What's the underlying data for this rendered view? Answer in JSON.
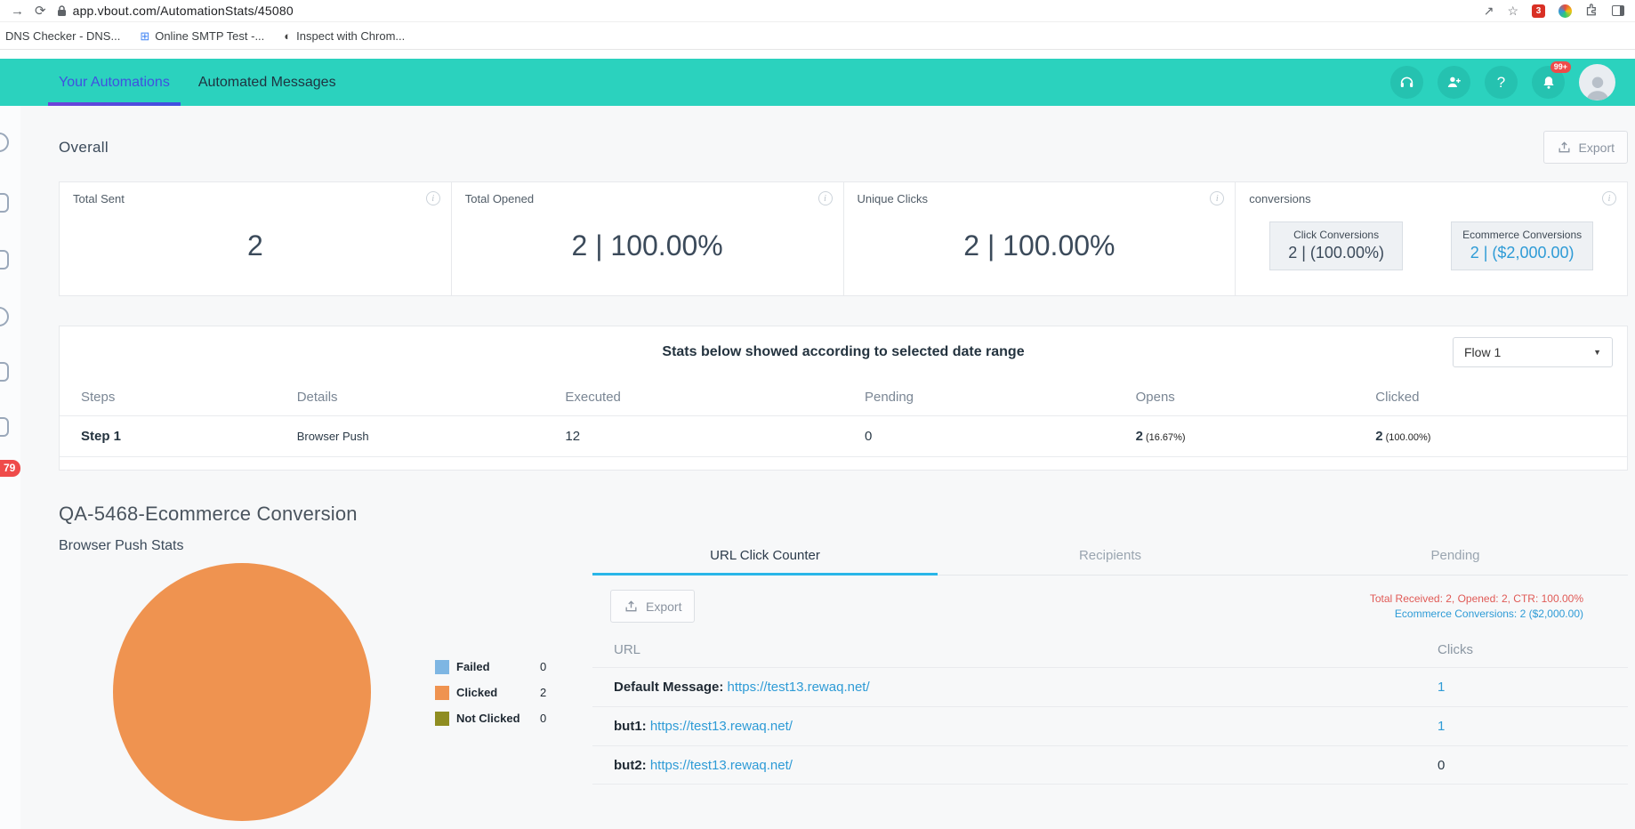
{
  "browser": {
    "url": "app.vbout.com/AutomationStats/45080",
    "extension_badge": "3",
    "bookmarks": [
      "DNS Checker - DNS...",
      "Online SMTP Test -...",
      "Inspect with Chrom..."
    ]
  },
  "header": {
    "tabs": [
      {
        "label": "Your Automations",
        "active": true
      },
      {
        "label": "Automated Messages",
        "active": false
      }
    ],
    "notification_badge": "99+"
  },
  "sidebar": {
    "badge": "79"
  },
  "overall": {
    "title": "Overall",
    "export_label": "Export",
    "cards": [
      {
        "label": "Total Sent",
        "value": "2"
      },
      {
        "label": "Total Opened",
        "value": "2 | 100.00%"
      },
      {
        "label": "Unique Clicks",
        "value": "2 | 100.00%"
      }
    ],
    "conversions": {
      "label": "conversions",
      "items": [
        {
          "label": "Click Conversions",
          "value": "2 | (100.00%)"
        },
        {
          "label": "Ecommerce Conversions",
          "value": "2 | ($2,000.00)"
        }
      ]
    }
  },
  "stats_table": {
    "caption": "Stats below showed according to selected date range",
    "flow_select": "Flow 1",
    "columns": [
      "Steps",
      "Details",
      "Executed",
      "Pending",
      "Opens",
      "Clicked"
    ],
    "rows": [
      {
        "steps": "Step 1",
        "details": "Browser Push",
        "executed": "12",
        "pending": "0",
        "opens": "2",
        "opens_pct": "(16.67%)",
        "clicked": "2",
        "clicked_pct": "(100.00%)"
      }
    ]
  },
  "campaign": {
    "title": "QA-5468-Ecommerce Conversion",
    "pie_title": "Browser Push Stats",
    "legend": [
      {
        "label": "Failed",
        "value": "0",
        "color": "#7eb6e3"
      },
      {
        "label": "Clicked",
        "value": "2",
        "color": "#ef9350"
      },
      {
        "label": "Not Clicked",
        "value": "0",
        "color": "#8f8d21"
      }
    ],
    "tabs": [
      {
        "label": "URL Click Counter",
        "active": true
      },
      {
        "label": "Recipients",
        "active": false
      },
      {
        "label": "Pending",
        "active": false
      }
    ],
    "export_label": "Export",
    "summary_line1": "Total Received: 2, Opened: 2, CTR: 100.00%",
    "summary_line2": "Ecommerce Conversions: 2 ($2,000.00)",
    "url_table": {
      "columns": [
        "URL",
        "Clicks"
      ],
      "rows": [
        {
          "prefix": "Default Message:",
          "url": "https://test13.rewaq.net/",
          "clicks": "1"
        },
        {
          "prefix": "but1:",
          "url": "https://test13.rewaq.net/",
          "clicks": "1"
        },
        {
          "prefix": "but2:",
          "url": "https://test13.rewaq.net/",
          "clicks": "0"
        }
      ]
    }
  },
  "colors": {
    "header_teal": "#2bd2be",
    "active_tab_blue": "#3f51e0",
    "accent_blue": "#2e9bd6",
    "pie_clicked_orange": "#ef9350",
    "legend_failed_blue": "#7eb6e3",
    "legend_not_clicked_olive": "#8f8d21",
    "alert_red": "#e05a56",
    "badge_red": "#ef4b4a"
  },
  "chart_data": {
    "type": "pie",
    "title": "Browser Push Stats",
    "categories": [
      "Failed",
      "Clicked",
      "Not Clicked"
    ],
    "values": [
      0,
      2,
      0
    ],
    "colors": [
      "#7eb6e3",
      "#ef9350",
      "#8f8d21"
    ],
    "legend_position": "right"
  }
}
